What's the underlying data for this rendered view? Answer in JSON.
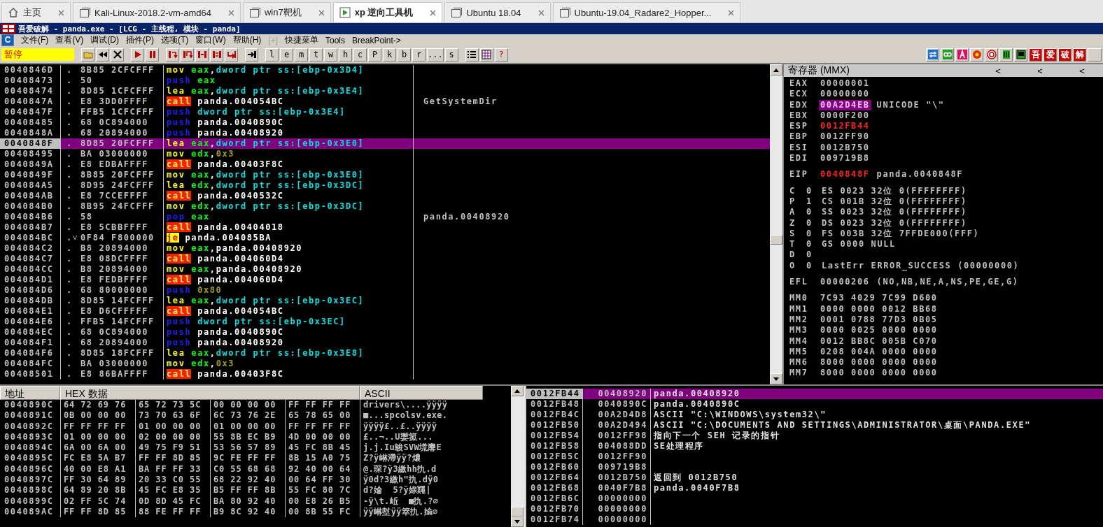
{
  "browser_tabs": [
    {
      "label": "主页",
      "kind": "home",
      "selected": false
    },
    {
      "label": "Kali-Linux-2018.2-vm-amd64",
      "kind": "vm",
      "selected": false
    },
    {
      "label": "win7靶机",
      "kind": "vm",
      "selected": false
    },
    {
      "label": "xp 逆向工具机",
      "kind": "running",
      "selected": true
    },
    {
      "label": "Ubuntu 18.04",
      "kind": "vm",
      "selected": false
    },
    {
      "label": "Ubuntu-19.04_Radare2_Hopper...",
      "kind": "vm",
      "selected": false
    }
  ],
  "window": {
    "title": "吾爱破解 - panda.exe - [LCG - 主线程, 模块 - panda]"
  },
  "menu": {
    "logo": "C",
    "items": [
      {
        "label": "文件(F)",
        "disabled": false
      },
      {
        "label": "查看(V)",
        "disabled": false
      },
      {
        "label": "调试(D)",
        "disabled": false
      },
      {
        "label": "插件(P)",
        "disabled": false
      },
      {
        "label": "选项(T)",
        "disabled": false
      },
      {
        "label": "窗口(W)",
        "disabled": false
      },
      {
        "label": "帮助(H)",
        "disabled": false
      },
      {
        "label": "[+]",
        "disabled": true
      },
      {
        "label": "快捷菜单",
        "disabled": false
      },
      {
        "label": "Tools",
        "disabled": false
      },
      {
        "label": "BreakPoint->",
        "disabled": false
      }
    ]
  },
  "toolbar": {
    "status": "暂停",
    "view_buttons": [
      "l",
      "e",
      "m",
      "t",
      "w",
      "h",
      "c",
      "P",
      "k",
      "b",
      "r",
      "...",
      "s"
    ],
    "help_button": "?",
    "plugin_buttons": [
      "吾",
      "爱",
      "破",
      "解"
    ]
  },
  "disassembly": [
    {
      "address": "0040846D",
      "marker": ".",
      "bytes": "8B85 2CFCFFF",
      "mnemonic": "mov",
      "kind": "data",
      "operands": [
        {
          "text": "eax",
          "kind": "register"
        },
        {
          "text": ",",
          "kind": "plain"
        },
        {
          "text": "dword ptr ss:[ebp-0x3D4]",
          "kind": "memory"
        }
      ],
      "selected": false
    },
    {
      "address": "00408473",
      "marker": ".",
      "bytes": "50",
      "mnemonic": "push",
      "kind": "stack",
      "operands": [
        {
          "text": "eax",
          "kind": "register"
        }
      ],
      "selected": false
    },
    {
      "address": "00408474",
      "marker": ".",
      "bytes": "8D85 1CFCFFF",
      "mnemonic": "lea",
      "kind": "data",
      "operands": [
        {
          "text": "eax",
          "kind": "register"
        },
        {
          "text": ",",
          "kind": "plain"
        },
        {
          "text": "dword ptr ss:[ebp-0x3E4]",
          "kind": "memory"
        }
      ],
      "selected": false
    },
    {
      "address": "0040847A",
      "marker": ".",
      "bytes": "E8 3DD0FFFF",
      "mnemonic": "call",
      "kind": "call",
      "operands": [
        {
          "text": "panda.004054BC",
          "kind": "label"
        }
      ],
      "comment": "GetSystemDir",
      "selected": false
    },
    {
      "address": "0040847F",
      "marker": ".",
      "bytes": "FFB5 1CFCFFF",
      "mnemonic": "push",
      "kind": "stack",
      "operands": [
        {
          "text": "dword ptr ss:[ebp-0x3E4]",
          "kind": "memory"
        }
      ],
      "selected": false
    },
    {
      "address": "00408485",
      "marker": ".",
      "bytes": "68 0C894000",
      "mnemonic": "push",
      "kind": "stack",
      "operands": [
        {
          "text": "panda.0040890C",
          "kind": "label"
        }
      ],
      "selected": false
    },
    {
      "address": "0040848A",
      "marker": ".",
      "bytes": "68 20894000",
      "mnemonic": "push",
      "kind": "stack",
      "operands": [
        {
          "text": "panda.00408920",
          "kind": "label"
        }
      ],
      "selected": false
    },
    {
      "address": "0040848F",
      "marker": ".",
      "bytes": "8D85 20FCFFF",
      "mnemonic": "lea",
      "kind": "data",
      "operands": [
        {
          "text": "eax",
          "kind": "register"
        },
        {
          "text": ",",
          "kind": "plain"
        },
        {
          "text": "dword ptr ss:[ebp-0x3E0]",
          "kind": "memory"
        }
      ],
      "selected": true
    },
    {
      "address": "00408495",
      "marker": ".",
      "bytes": "BA 03000000",
      "mnemonic": "mov",
      "kind": "data",
      "operands": [
        {
          "text": "edx",
          "kind": "register"
        },
        {
          "text": ",",
          "kind": "plain"
        },
        {
          "text": "0x3",
          "kind": "constant"
        }
      ],
      "selected": false
    },
    {
      "address": "0040849A",
      "marker": ".",
      "bytes": "E8 EDBAFFFF",
      "mnemonic": "call",
      "kind": "call",
      "operands": [
        {
          "text": "panda.00403F8C",
          "kind": "label"
        }
      ],
      "selected": false
    },
    {
      "address": "0040849F",
      "marker": ".",
      "bytes": "8B85 20FCFFF",
      "mnemonic": "mov",
      "kind": "data",
      "operands": [
        {
          "text": "eax",
          "kind": "register"
        },
        {
          "text": ",",
          "kind": "plain"
        },
        {
          "text": "dword ptr ss:[ebp-0x3E0]",
          "kind": "memory"
        }
      ],
      "selected": false
    },
    {
      "address": "004084A5",
      "marker": ".",
      "bytes": "8D95 24FCFFF",
      "mnemonic": "lea",
      "kind": "data",
      "operands": [
        {
          "text": "edx",
          "kind": "register"
        },
        {
          "text": ",",
          "kind": "plain"
        },
        {
          "text": "dword ptr ss:[ebp-0x3DC]",
          "kind": "memory"
        }
      ],
      "selected": false
    },
    {
      "address": "004084AB",
      "marker": ".",
      "bytes": "E8 7CCEFFFF",
      "mnemonic": "call",
      "kind": "call",
      "operands": [
        {
          "text": "panda.0040532C",
          "kind": "label"
        }
      ],
      "selected": false
    },
    {
      "address": "004084B0",
      "marker": ".",
      "bytes": "8B95 24FCFFF",
      "mnemonic": "mov",
      "kind": "data",
      "operands": [
        {
          "text": "edx",
          "kind": "register"
        },
        {
          "text": ",",
          "kind": "plain"
        },
        {
          "text": "dword ptr ss:[ebp-0x3DC]",
          "kind": "memory"
        }
      ],
      "selected": false
    },
    {
      "address": "004084B6",
      "marker": ".",
      "bytes": "58",
      "mnemonic": "pop",
      "kind": "stack",
      "operands": [
        {
          "text": "eax",
          "kind": "register"
        }
      ],
      "comment": "panda.00408920",
      "selected": false
    },
    {
      "address": "004084B7",
      "marker": ".",
      "bytes": "E8 5CBBFFFF",
      "mnemonic": "call",
      "kind": "call",
      "operands": [
        {
          "text": "panda.00404018",
          "kind": "label"
        }
      ],
      "selected": false
    },
    {
      "address": "004084BC",
      "marker": ".˅",
      "bytes": "0F84 F800000",
      "mnemonic": "je",
      "kind": "jump",
      "operands": [
        {
          "text": "panda.004085BA",
          "kind": "label"
        }
      ],
      "selected": false
    },
    {
      "address": "004084C2",
      "marker": ".",
      "bytes": "B8 20894000",
      "mnemonic": "mov",
      "kind": "data",
      "operands": [
        {
          "text": "eax",
          "kind": "register"
        },
        {
          "text": ",",
          "kind": "plain"
        },
        {
          "text": "panda.00408920",
          "kind": "label"
        }
      ],
      "selected": false
    },
    {
      "address": "004084C7",
      "marker": ".",
      "bytes": "E8 08DCFFFF",
      "mnemonic": "call",
      "kind": "call",
      "operands": [
        {
          "text": "panda.004060D4",
          "kind": "label"
        }
      ],
      "selected": false
    },
    {
      "address": "004084CC",
      "marker": ".",
      "bytes": "B8 20894000",
      "mnemonic": "mov",
      "kind": "data",
      "operands": [
        {
          "text": "eax",
          "kind": "register"
        },
        {
          "text": ",",
          "kind": "plain"
        },
        {
          "text": "panda.00408920",
          "kind": "label"
        }
      ],
      "selected": false
    },
    {
      "address": "004084D1",
      "marker": ".",
      "bytes": "E8 FEDBFFFF",
      "mnemonic": "call",
      "kind": "call",
      "operands": [
        {
          "text": "panda.004060D4",
          "kind": "label"
        }
      ],
      "selected": false
    },
    {
      "address": "004084D6",
      "marker": ".",
      "bytes": "68 80000000",
      "mnemonic": "push",
      "kind": "stack",
      "operands": [
        {
          "text": "0x80",
          "kind": "constant"
        }
      ],
      "selected": false
    },
    {
      "address": "004084DB",
      "marker": ".",
      "bytes": "8D85 14FCFFF",
      "mnemonic": "lea",
      "kind": "data",
      "operands": [
        {
          "text": "eax",
          "kind": "register"
        },
        {
          "text": ",",
          "kind": "plain"
        },
        {
          "text": "dword ptr ss:[ebp-0x3EC]",
          "kind": "memory"
        }
      ],
      "selected": false
    },
    {
      "address": "004084E1",
      "marker": ".",
      "bytes": "E8 D6CFFFFF",
      "mnemonic": "call",
      "kind": "call",
      "operands": [
        {
          "text": "panda.004054BC",
          "kind": "label"
        }
      ],
      "selected": false
    },
    {
      "address": "004084E6",
      "marker": ".",
      "bytes": "FFB5 14FCFFF",
      "mnemonic": "push",
      "kind": "stack",
      "operands": [
        {
          "text": "dword ptr ss:[ebp-0x3EC]",
          "kind": "memory"
        }
      ],
      "selected": false
    },
    {
      "address": "004084EC",
      "marker": ".",
      "bytes": "68 0C894000",
      "mnemonic": "push",
      "kind": "stack",
      "operands": [
        {
          "text": "panda.0040890C",
          "kind": "label"
        }
      ],
      "selected": false
    },
    {
      "address": "004084F1",
      "marker": ".",
      "bytes": "68 20894000",
      "mnemonic": "push",
      "kind": "stack",
      "operands": [
        {
          "text": "panda.00408920",
          "kind": "label"
        }
      ],
      "selected": false
    },
    {
      "address": "004084F6",
      "marker": ".",
      "bytes": "8D85 18FCFFF",
      "mnemonic": "lea",
      "kind": "data",
      "operands": [
        {
          "text": "eax",
          "kind": "register"
        },
        {
          "text": ",",
          "kind": "plain"
        },
        {
          "text": "dword ptr ss:[ebp-0x3E8]",
          "kind": "memory"
        }
      ],
      "selected": false
    },
    {
      "address": "004084FC",
      "marker": ".",
      "bytes": "BA 03000000",
      "mnemonic": "mov",
      "kind": "data",
      "operands": [
        {
          "text": "edx",
          "kind": "register"
        },
        {
          "text": ",",
          "kind": "plain"
        },
        {
          "text": "0x3",
          "kind": "constant"
        }
      ],
      "selected": false
    },
    {
      "address": "00408501",
      "marker": ".",
      "bytes": "E8 86BAFFFF",
      "mnemonic": "call",
      "kind": "call",
      "operands": [
        {
          "text": "panda.00403F8C",
          "kind": "label"
        }
      ],
      "selected": false
    }
  ],
  "registers": {
    "title": "寄存器 (MMX)",
    "header_buttons": [
      "<",
      "<",
      "<"
    ],
    "general": [
      {
        "name": "EAX",
        "value": "00000001",
        "changed": false,
        "selected": false
      },
      {
        "name": "ECX",
        "value": "00000000",
        "changed": false,
        "selected": false
      },
      {
        "name": "EDX",
        "value": "00A2D4EB",
        "changed": false,
        "selected": true,
        "comment": "UNICODE \"\\\""
      },
      {
        "name": "EBX",
        "value": "0000F200",
        "changed": false,
        "selected": false
      },
      {
        "name": "ESP",
        "value": "0012FB44",
        "changed": true,
        "selected": false
      },
      {
        "name": "EBP",
        "value": "0012FF90",
        "changed": false,
        "selected": false
      },
      {
        "name": "ESI",
        "value": "0012B750",
        "changed": false,
        "selected": false
      },
      {
        "name": "EDI",
        "value": "009719B8",
        "changed": false,
        "selected": false
      }
    ],
    "eip": {
      "name": "EIP",
      "value": "0040848F",
      "changed": true,
      "selected": false,
      "comment": "panda.0040848F"
    },
    "flags": [
      {
        "flag": "C",
        "value": "0",
        "detail": "ES 0023 32位 0(FFFFFFFF)"
      },
      {
        "flag": "P",
        "value": "1",
        "detail": "CS 001B 32位 0(FFFFFFFF)"
      },
      {
        "flag": "A",
        "value": "0",
        "detail": "SS 0023 32位 0(FFFFFFFF)"
      },
      {
        "flag": "Z",
        "value": "0",
        "detail": "DS 0023 32位 0(FFFFFFFF)"
      },
      {
        "flag": "S",
        "value": "0",
        "detail": "FS 003B 32位 7FFDE000(FFF)"
      },
      {
        "flag": "T",
        "value": "0",
        "detail": "GS 0000 NULL"
      },
      {
        "flag": "D",
        "value": "0"
      },
      {
        "flag": "O",
        "value": "0",
        "detail": "LastErr ERROR_SUCCESS (00000000)"
      }
    ],
    "efl": {
      "name": "EFL",
      "value": "00000206",
      "changed": false,
      "selected": false,
      "comment": "(NO,NB,NE,A,NS,PE,GE,G)"
    },
    "mmx": [
      {
        "name": "MM0",
        "value": "7C93 4029 7C99 D600"
      },
      {
        "name": "MM1",
        "value": "0000 0000 0012 BB68"
      },
      {
        "name": "MM2",
        "value": "0001 0788 77D3 0B05"
      },
      {
        "name": "MM3",
        "value": "0000 0025 0000 0000"
      },
      {
        "name": "MM4",
        "value": "0012 BB8C 005B C070"
      },
      {
        "name": "MM5",
        "value": "0208 004A 0000 0000"
      },
      {
        "name": "MM6",
        "value": "8000 0000 0000 0000"
      },
      {
        "name": "MM7",
        "value": "8000 0000 0000 0000"
      }
    ]
  },
  "dump": {
    "columns": [
      "地址",
      "HEX 数据",
      "ASCII"
    ],
    "rows": [
      {
        "address": "0040890C",
        "bytes": [
          "64 72 69 76",
          "65 72 73 5C",
          "00 00 00 00",
          "FF FF FF FF"
        ],
        "ascii": "drivers\\....ÿÿÿÿ"
      },
      {
        "address": "0040891C",
        "bytes": [
          "0B 00 00 00",
          "73 70 63 6F",
          "6C 73 76 2E",
          "65 78 65 00"
        ],
        "ascii": "■...spcolsv.exe."
      },
      {
        "address": "0040892C",
        "bytes": [
          "FF FF FF FF",
          "01 00 00 00",
          "01 00 00 00",
          "FF FF FF FF"
        ],
        "ascii": "ÿÿÿÿ£..£..ÿÿÿÿ"
      },
      {
        "address": "0040893C",
        "bytes": [
          "01 00 00 00",
          "02 00 00 00",
          "55 8B EC B9",
          "4D 00 00 00"
        ],
        "ascii": "£..¬..U嬱箛..."
      },
      {
        "address": "0040894C",
        "bytes": [
          "6A 00 6A 00",
          "49 75 F9 51",
          "53 56 57 89",
          "45 FC 8B 45"
        ],
        "ascii": "j.j.Iu鵔SVW塃麐E"
      },
      {
        "address": "0040895C",
        "bytes": [
          "FC E8 5A B7",
          "FF FF 8D 85",
          "9C FE FF FF",
          "8B 15 A0 75"
        ],
        "ascii": "Z?ÿ崊滯ÿÿ?燶"
      },
      {
        "address": "0040896C",
        "bytes": [
          "40 00 E8 A1",
          "BA FF FF 33",
          "C0 55 68 68",
          "92 40 00 64"
        ],
        "ascii": "@.琛?ÿ3繳hh扏.d"
      },
      {
        "address": "0040897C",
        "bytes": [
          "FF 30 64 89",
          "20 33 C0 55",
          "68 22 92 40",
          "00 64 FF 30"
        ],
        "ascii": "ÿ0d?3繳h\"扏.dÿ0"
      },
      {
        "address": "0040898C",
        "bytes": [
          "64 89 20 8B",
          "45 FC E8 35",
          "B5 FF FF 8B",
          "55 FC 80 7C"
        ],
        "ascii": "d?婨  5?ÿ媇鼆|"
      },
      {
        "address": "0040899C",
        "bytes": [
          "02 FF 5C 74",
          "0D 8D 45 FC",
          "BA 80 92 40",
          "00 E8 26 B5"
        ],
        "ascii": "-ÿ\\t.岴  ■扏.?∅"
      },
      {
        "address": "004089AC",
        "bytes": [
          "FF FF 8D 85",
          "88 FE FF FF",
          "B9 8C 92 40",
          "00 8B 55 FC"
        ],
        "ascii": "ÿÿ崊堼ÿÿ箤扏.婾∅"
      }
    ]
  },
  "stack": [
    {
      "address": "0012FB44",
      "value": "00408920",
      "comment": "panda.00408920",
      "selected": true
    },
    {
      "address": "0012FB48",
      "value": "0040890C",
      "comment": "panda.0040890C",
      "selected": false
    },
    {
      "address": "0012FB4C",
      "value": "00A2D4D8",
      "comment": "ASCII \"C:\\WINDOWS\\system32\\\"",
      "selected": false
    },
    {
      "address": "0012FB50",
      "value": "00A2D494",
      "comment": "ASCII \"C:\\DOCUMENTS AND SETTINGS\\ADMINISTRATOR\\桌面\\PANDA.EXE\"",
      "selected": false
    },
    {
      "address": "0012FB54",
      "value": "0012FF98",
      "comment": "指向下一个 SEH 记录的指针",
      "selected": false
    },
    {
      "address": "0012FB58",
      "value": "004088DD",
      "comment": "SE处理程序",
      "selected": false
    },
    {
      "address": "0012FB5C",
      "value": "0012FF90",
      "selected": false
    },
    {
      "address": "0012FB60",
      "value": "009719B8",
      "selected": false
    },
    {
      "address": "0012FB64",
      "value": "0012B750",
      "comment": "返回到 0012B750",
      "selected": false
    },
    {
      "address": "0012FB68",
      "value": "0040F7B8",
      "comment": "panda.0040F7B8",
      "selected": false
    },
    {
      "address": "0012FB6C",
      "value": "00000000",
      "selected": false
    },
    {
      "address": "0012FB70",
      "value": "00000000",
      "selected": false
    },
    {
      "address": "0012FB74",
      "value": "00000000",
      "selected": false
    }
  ]
}
